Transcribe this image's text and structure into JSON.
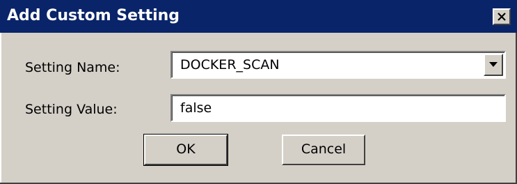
{
  "dialog": {
    "title": "Add Custom Setting",
    "close_icon": "close-icon"
  },
  "form": {
    "setting_name_label": "Setting Name:",
    "setting_name_value": "DOCKER_SCAN",
    "setting_value_label": "Setting Value:",
    "setting_value_value": "false"
  },
  "buttons": {
    "ok_label": "OK",
    "cancel_label": "Cancel"
  },
  "colors": {
    "titlebar": "#0a246a",
    "dialog_bg": "#d4d0c8",
    "field_bg": "#ffffff"
  }
}
